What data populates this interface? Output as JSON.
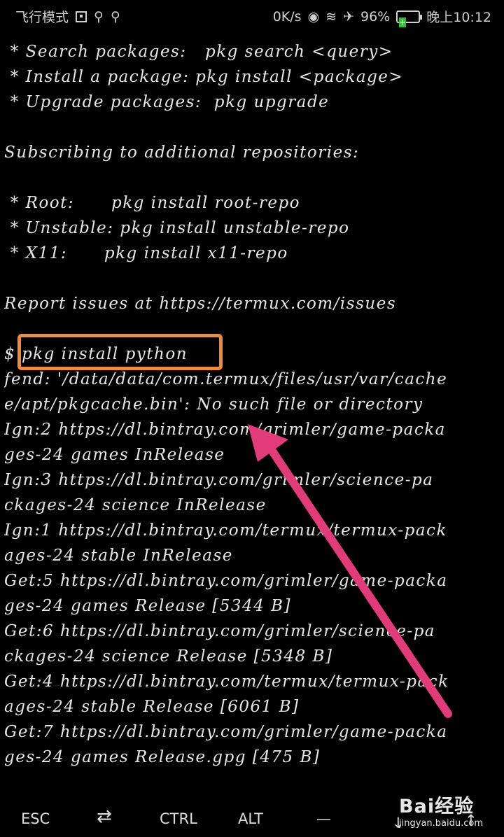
{
  "status_bar": {
    "left_text": "飞行模式",
    "left_icons": [
      "sim-icon",
      "usb-icon",
      "usb-icon"
    ],
    "speed": "0K/s",
    "battery_percent": "96%",
    "time": "晚上10:12"
  },
  "terminal": {
    "lines": [
      " * Search packages:   pkg search <query>",
      " * Install a package: pkg install <package>",
      " * Upgrade packages:  pkg upgrade",
      "",
      "Subscribing to additional repositories:",
      "",
      " * Root:      pkg install root-repo",
      " * Unstable: pkg install unstable-repo",
      " * X11:      pkg install x11-repo",
      "",
      "Report issues at https://termux.com/issues",
      "",
      "$ pkg install python",
      "fend: '/data/data/com.termux/files/usr/var/cache",
      "e/apt/pkgcache.bin': No such file or directory",
      "Ign:2 https://dl.bintray.com/grimler/game-packa",
      "ges-24 games InRelease",
      "Ign:3 https://dl.bintray.com/grimler/science-pa",
      "ckages-24 science InRelease",
      "Ign:1 https://dl.bintray.com/termux/termux-pack",
      "ages-24 stable InRelease",
      "Get:5 https://dl.bintray.com/grimler/game-packa",
      "ges-24 games Release [5344 B]",
      "Get:6 https://dl.bintray.com/grimler/science-pa",
      "ckages-24 science Release [5348 B]",
      "Get:4 https://dl.bintray.com/termux/termux-pack",
      "ages-24 stable Release [6061 B]",
      "Get:7 https://dl.bintray.com/grimler/game-packa",
      "ges-24 games Release.gpg [475 B]"
    ]
  },
  "extra_keys": {
    "esc": "ESC",
    "tab": "⇄",
    "ctrl": "CTRL",
    "alt": "ALT",
    "dash": "—",
    "down": "↓",
    "up": "↑"
  },
  "watermark": {
    "logo": "Bai经验",
    "url": "jingyan.baidu.com"
  },
  "colors": {
    "highlight_box": "#ef8a3c",
    "arrow": "#e23b7a",
    "battery": "#2fbf2f"
  }
}
